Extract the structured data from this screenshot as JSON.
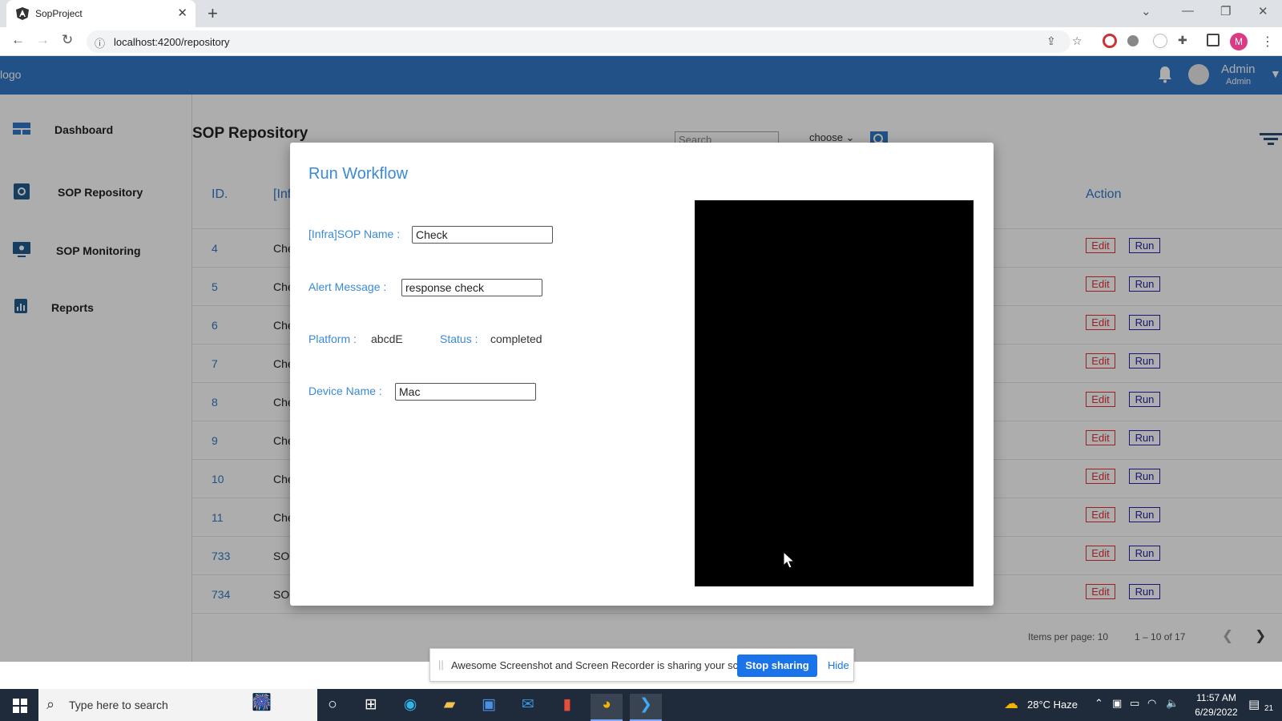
{
  "browser": {
    "tab_title": "SopProject",
    "tab_close": "✕",
    "new_tab": "+",
    "url": "localhost:4200/repository",
    "profile_initial": "M",
    "win_minimize": "—",
    "win_restore": "❐",
    "win_close": "✕",
    "tab_search": "⌄"
  },
  "header": {
    "logo": "logo",
    "user_name": "Admin",
    "user_role": "Admin"
  },
  "sidebar": {
    "items": [
      {
        "label": "Dashboard",
        "icon": "dashboard-icon"
      },
      {
        "label": "SOP Repository",
        "icon": "repository-icon"
      },
      {
        "label": "SOP Monitoring",
        "icon": "monitor-icon"
      },
      {
        "label": "Reports",
        "icon": "reports-icon"
      }
    ]
  },
  "main": {
    "title": "SOP Repository",
    "search_placeholder": "Search",
    "filter_select": "choose",
    "columns": {
      "id": "ID.",
      "name": "[Infra]SOP Name",
      "action": "Action"
    },
    "rows": [
      {
        "id": "4",
        "name": "Che"
      },
      {
        "id": "5",
        "name": "Che"
      },
      {
        "id": "6",
        "name": "Che"
      },
      {
        "id": "7",
        "name": "Che"
      },
      {
        "id": "8",
        "name": "Che"
      },
      {
        "id": "9",
        "name": "Che"
      },
      {
        "id": "10",
        "name": "Che"
      },
      {
        "id": "11",
        "name": "Che"
      },
      {
        "id": "733",
        "name": "SO"
      },
      {
        "id": "734",
        "name": "SO"
      }
    ],
    "edit_label": "Edit",
    "run_label": "Run",
    "paginator": {
      "items_per_page": "Items per page:",
      "page_size": "10",
      "range": "1 – 10 of 17"
    }
  },
  "modal": {
    "title": "Run Workflow",
    "sop_name_label": "[Infra]SOP Name :",
    "sop_name_value": "Check",
    "alert_label": "Alert Message :",
    "alert_value": "response check",
    "platform_label": "Platform :",
    "platform_value": "abcdE",
    "status_label": "Status :",
    "status_value": "completed",
    "device_label": "Device Name :",
    "device_value": "Mac"
  },
  "share_bar": {
    "grip": "||",
    "message": "Awesome Screenshot and Screen Recorder is sharing your screen.",
    "stop_label": "Stop sharing",
    "hide_label": "Hide"
  },
  "taskbar": {
    "search_placeholder": "Type here to search",
    "weather": "28°C  Haze",
    "time": "11:57 AM",
    "date": "6/29/2022",
    "notifications": "21"
  },
  "colors": {
    "accent": "#3178c6",
    "modal_label": "#3a8ad6",
    "edit": "#dd3333",
    "run": "#2222aa"
  }
}
